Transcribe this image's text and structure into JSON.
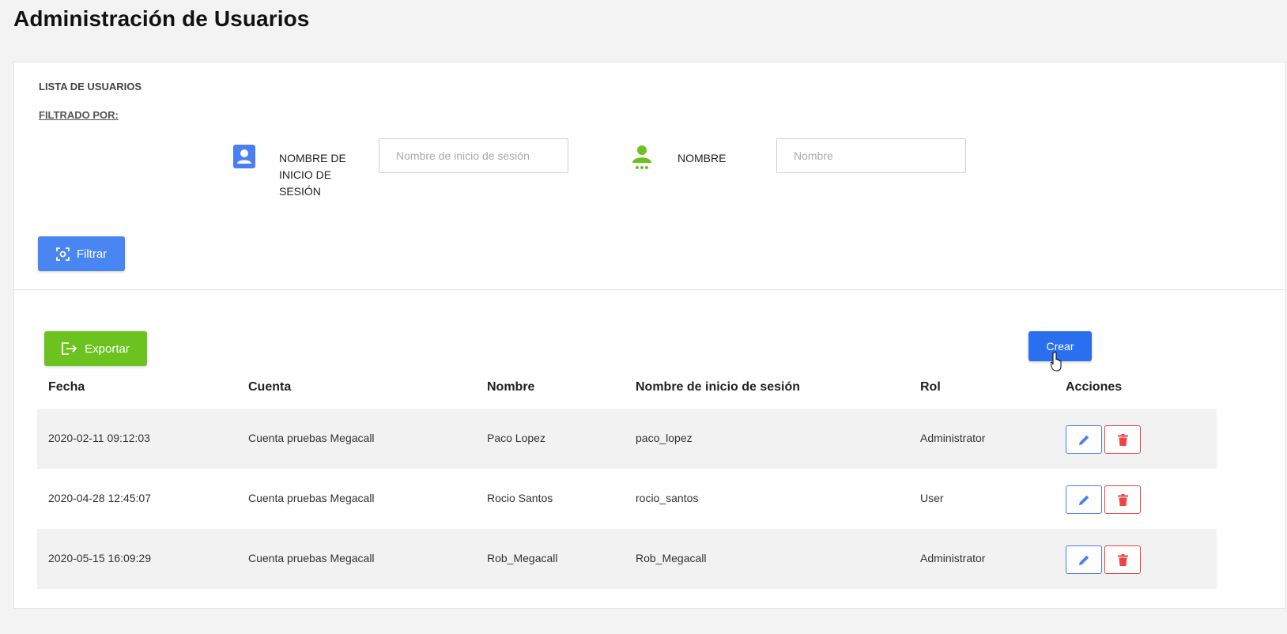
{
  "page": {
    "title": "Administración de Usuarios"
  },
  "filter_panel": {
    "title": "LISTA DE USUARIOS",
    "filter_by": "FILTRADO POR:",
    "login_filter": {
      "label": "NOMBRE DE INICIO DE SESIÓN",
      "placeholder": "Nombre de inicio de sesión",
      "value": "",
      "icon": "user-card-icon",
      "icon_color": "#4a7ef3"
    },
    "name_filter": {
      "label": "NOMBRE",
      "placeholder": "Nombre",
      "value": "",
      "icon": "person-icon",
      "icon_color": "#6cc21f"
    },
    "filter_button": {
      "label": "Filtrar",
      "icon": "scan-focus-icon",
      "color": "#4a86f3"
    }
  },
  "toolbar": {
    "export_button": {
      "label": "Exportar",
      "icon": "export-icon",
      "color": "#6cc21f"
    },
    "create_button": {
      "label": "Crear",
      "color": "#2a6ff0"
    }
  },
  "table": {
    "columns": [
      "Fecha",
      "Cuenta",
      "Nombre",
      "Nombre de inicio de sesión",
      "Rol",
      "Acciones"
    ],
    "rows": [
      {
        "fecha": "2020-02-11 09:12:03",
        "cuenta": "Cuenta pruebas Megacall",
        "nombre": "Paco Lopez",
        "login": "paco_lopez",
        "rol": "Administrator"
      },
      {
        "fecha": "2020-04-28 12:45:07",
        "cuenta": "Cuenta pruebas Megacall",
        "nombre": "Rocio Santos",
        "login": "rocio_santos",
        "rol": "User"
      },
      {
        "fecha": "2020-05-15 16:09:29",
        "cuenta": "Cuenta pruebas Megacall",
        "nombre": "Rob_Megacall",
        "login": "Rob_Megacall",
        "rol": "Administrator"
      }
    ],
    "actions": {
      "edit_icon": "pencil-icon",
      "delete_icon": "trash-icon",
      "edit_color": "#4a7ef3",
      "delete_color": "#ee4444"
    }
  }
}
